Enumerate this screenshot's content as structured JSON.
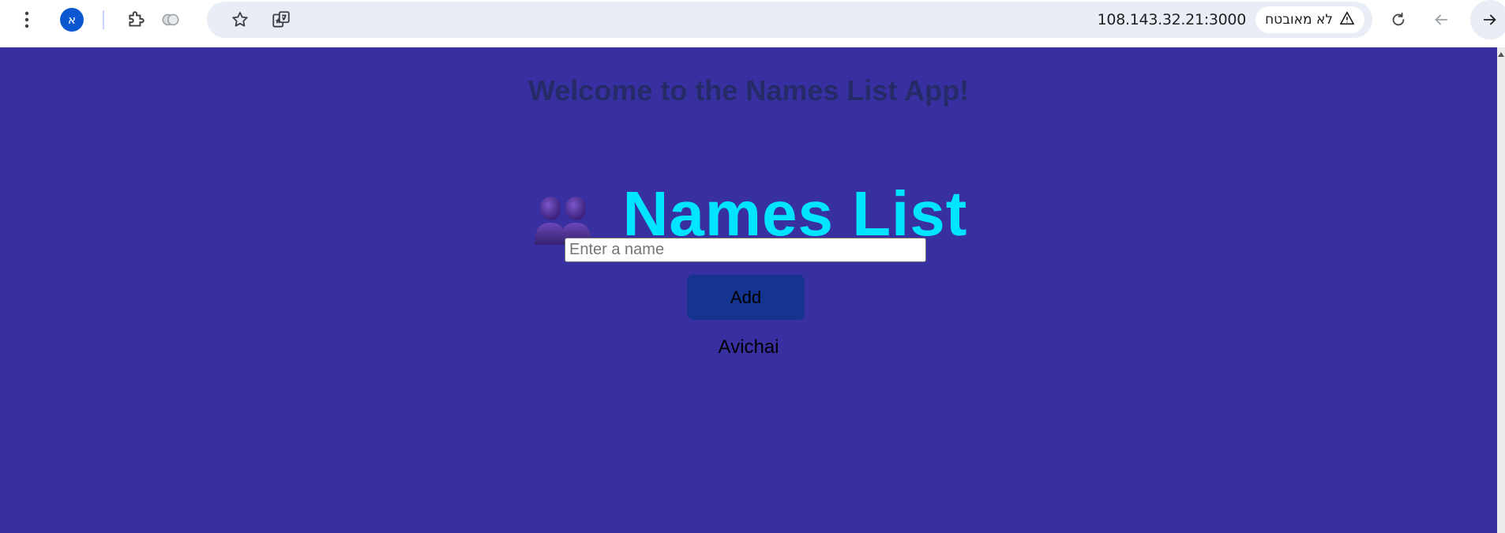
{
  "browser": {
    "url": "108.143.32.21:3000",
    "security_label": "לא מאובטח",
    "profile_initial": "א",
    "colors": {
      "toolbar_bg": "#ffffff",
      "omnibox_bg": "#e9eef6",
      "avatar_bg": "#0b57d0"
    }
  },
  "page": {
    "welcome": "Welcome to the Names List App!",
    "heading": "Names List",
    "heading_icon": "people-emoji",
    "input": {
      "placeholder": "Enter a name",
      "value": ""
    },
    "add_button_label": "Add",
    "names": [
      "Avichai"
    ],
    "colors": {
      "background": "#382fa1",
      "welcome_text": "#262b68",
      "heading_text": "#00e5ff",
      "button_bg": "#14348f"
    }
  }
}
